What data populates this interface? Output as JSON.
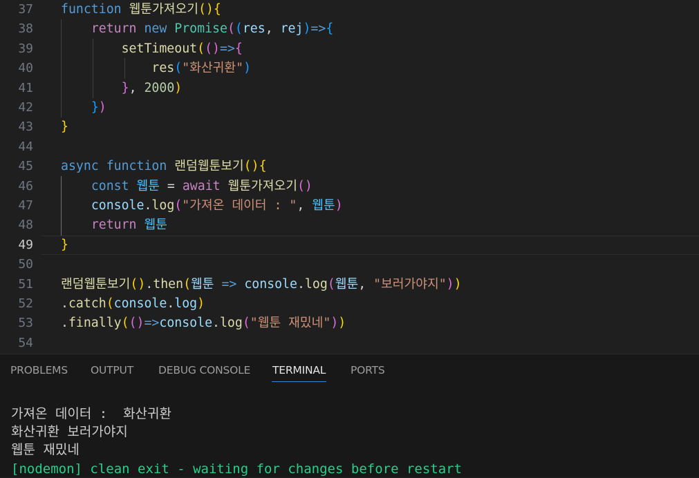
{
  "editor": {
    "active_line": "49",
    "lines": [
      {
        "n": "37",
        "t": [
          [
            "t-kw",
            "function"
          ],
          [
            "t-p",
            " "
          ],
          [
            "t-fn",
            "웹툰가져오기"
          ],
          [
            "b1",
            "()"
          ],
          [
            "b1",
            "{"
          ]
        ]
      },
      {
        "n": "38",
        "t": [
          [
            "t-p",
            "    "
          ],
          [
            "t-ctl",
            "return"
          ],
          [
            "t-p",
            " "
          ],
          [
            "t-kw",
            "new"
          ],
          [
            "t-p",
            " "
          ],
          [
            "t-cls",
            "Promise"
          ],
          [
            "b2",
            "("
          ],
          [
            "b3",
            "("
          ],
          [
            "t-var",
            "res"
          ],
          [
            "t-p",
            ", "
          ],
          [
            "t-var",
            "rej"
          ],
          [
            "b3",
            ")"
          ],
          [
            "t-kw",
            "=>"
          ],
          [
            "b3",
            "{"
          ]
        ]
      },
      {
        "n": "39",
        "t": [
          [
            "t-p",
            "        "
          ],
          [
            "t-fn",
            "setTimeout"
          ],
          [
            "b1",
            "("
          ],
          [
            "b2",
            "()"
          ],
          [
            "t-kw",
            "=>"
          ],
          [
            "b2",
            "{"
          ]
        ]
      },
      {
        "n": "40",
        "t": [
          [
            "t-p",
            "            "
          ],
          [
            "t-fn",
            "res"
          ],
          [
            "b3",
            "("
          ],
          [
            "t-str",
            "\"화산귀환\""
          ],
          [
            "b3",
            ")"
          ]
        ]
      },
      {
        "n": "41",
        "t": [
          [
            "t-p",
            "        "
          ],
          [
            "b2",
            "}"
          ],
          [
            "t-p",
            ", "
          ],
          [
            "t-num",
            "2000"
          ],
          [
            "b1",
            ")"
          ]
        ]
      },
      {
        "n": "42",
        "t": [
          [
            "t-p",
            "    "
          ],
          [
            "b3",
            "}"
          ],
          [
            "b2",
            ")"
          ]
        ]
      },
      {
        "n": "43",
        "t": [
          [
            "b1",
            "}"
          ]
        ]
      },
      {
        "n": "44",
        "t": []
      },
      {
        "n": "45",
        "t": [
          [
            "t-kw",
            "async"
          ],
          [
            "t-p",
            " "
          ],
          [
            "t-kw",
            "function"
          ],
          [
            "t-p",
            " "
          ],
          [
            "t-fn",
            "랜덤웹툰보기"
          ],
          [
            "b1",
            "()"
          ],
          [
            "b1",
            "{"
          ]
        ]
      },
      {
        "n": "46",
        "t": [
          [
            "t-p",
            "    "
          ],
          [
            "t-kw",
            "const"
          ],
          [
            "t-p",
            " "
          ],
          [
            "t-var2",
            "웹툰"
          ],
          [
            "t-p",
            " = "
          ],
          [
            "t-ctl",
            "await"
          ],
          [
            "t-p",
            " "
          ],
          [
            "t-fn",
            "웹툰가져오기"
          ],
          [
            "b2",
            "()"
          ]
        ]
      },
      {
        "n": "47",
        "t": [
          [
            "t-p",
            "    "
          ],
          [
            "t-var",
            "console"
          ],
          [
            "t-p",
            "."
          ],
          [
            "t-fn",
            "log"
          ],
          [
            "b2",
            "("
          ],
          [
            "t-str",
            "\"가져온 데이터 : \""
          ],
          [
            "t-p",
            ", "
          ],
          [
            "t-var2",
            "웹툰"
          ],
          [
            "b2",
            ")"
          ]
        ]
      },
      {
        "n": "48",
        "t": [
          [
            "t-p",
            "    "
          ],
          [
            "t-ctl",
            "return"
          ],
          [
            "t-p",
            " "
          ],
          [
            "t-var2",
            "웹툰"
          ]
        ]
      },
      {
        "n": "49",
        "t": [
          [
            "b1",
            "}"
          ]
        ]
      },
      {
        "n": "50",
        "t": []
      },
      {
        "n": "51",
        "t": [
          [
            "t-fn",
            "랜덤웹툰보기"
          ],
          [
            "b1",
            "()"
          ],
          [
            "t-p",
            "."
          ],
          [
            "t-fn",
            "then"
          ],
          [
            "b1",
            "("
          ],
          [
            "t-var",
            "웹툰"
          ],
          [
            "t-p",
            " "
          ],
          [
            "t-kw",
            "=>"
          ],
          [
            "t-p",
            " "
          ],
          [
            "t-var",
            "console"
          ],
          [
            "t-p",
            "."
          ],
          [
            "t-fn",
            "log"
          ],
          [
            "b2",
            "("
          ],
          [
            "t-var",
            "웹툰"
          ],
          [
            "t-p",
            ", "
          ],
          [
            "t-str",
            "\"보러가야지\""
          ],
          [
            "b2",
            ")"
          ],
          [
            "b1",
            ")"
          ]
        ]
      },
      {
        "n": "52",
        "t": [
          [
            "t-p",
            "."
          ],
          [
            "t-fn",
            "catch"
          ],
          [
            "b1",
            "("
          ],
          [
            "t-var",
            "console"
          ],
          [
            "t-p",
            "."
          ],
          [
            "t-var",
            "log"
          ],
          [
            "b1",
            ")"
          ]
        ]
      },
      {
        "n": "53",
        "t": [
          [
            "t-p",
            "."
          ],
          [
            "t-fn",
            "finally"
          ],
          [
            "b1",
            "("
          ],
          [
            "b2",
            "()"
          ],
          [
            "t-kw",
            "=>"
          ],
          [
            "t-var",
            "console"
          ],
          [
            "t-p",
            "."
          ],
          [
            "t-fn",
            "log"
          ],
          [
            "b2",
            "("
          ],
          [
            "t-str",
            "\"웹툰 재밌네\""
          ],
          [
            "b2",
            ")"
          ],
          [
            "b1",
            ")"
          ]
        ]
      },
      {
        "n": "54",
        "t": []
      }
    ]
  },
  "panel": {
    "tabs": [
      "PROBLEMS",
      "OUTPUT",
      "DEBUG CONSOLE",
      "TERMINAL",
      "PORTS"
    ],
    "active_tab": "TERMINAL",
    "terminal_lines": [
      "가져온 데이터 :  화산귀환",
      "화산귀환 보러가야지",
      "웹툰 재밌네",
      "[nodemon] clean exit - waiting for changes before restart"
    ]
  }
}
